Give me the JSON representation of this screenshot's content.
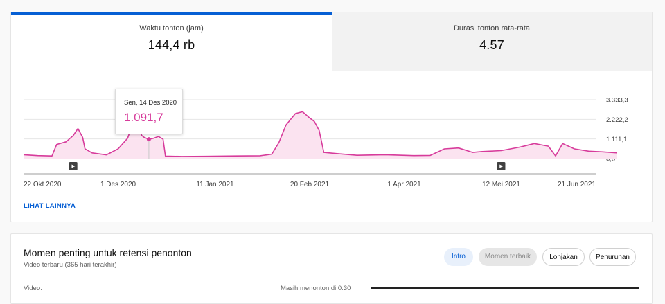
{
  "metrics": [
    {
      "label": "Waktu tonton (jam)",
      "value": "144,4 rb"
    },
    {
      "label": "Durasi tonton rata-rata",
      "value": "4.57"
    }
  ],
  "colors": {
    "accent": "#065fd4",
    "series": "#d73b9b",
    "series_fill": "#fbe3f0"
  },
  "tooltip": {
    "date": "Sen, 14 Des 2020",
    "value": "1.091,7"
  },
  "see_more": "LIHAT LAINNYA",
  "icons": {
    "video_marker": "play-icon"
  },
  "retention": {
    "title": "Momen penting untuk retensi penonton",
    "subtitle": "Video terbaru (365 hari terakhir)",
    "chips": [
      "Intro",
      "Momen terbaik",
      "Lonjakan",
      "Penurunan"
    ],
    "selected_chip": "Intro",
    "cut_left": "Video:",
    "cut_right": "Masih menonton di 0:30"
  },
  "chart_data": {
    "type": "area",
    "metric": "Waktu tonton (jam)",
    "x_labels": [
      "22 Okt 2020",
      "1 Des 2020",
      "11 Jan 2021",
      "20 Feb 2021",
      "1 Apr 2021",
      "12 Mei 2021",
      "21 Jun 2021"
    ],
    "x_start": "2020-10-22",
    "y_ticks": [
      "0,0",
      "1.111,1",
      "2.222,2",
      "3.333,3"
    ],
    "y_tick_values": [
      0,
      1111.1,
      2222.2,
      3333.3
    ],
    "ylim": [
      0,
      3333.3
    ],
    "video_markers": [
      "2020-11-12",
      "2021-05-12"
    ],
    "highlight": {
      "date": "2020-12-14",
      "value": 1091.7
    },
    "series": [
      {
        "date": "2020-10-22",
        "value": 220
      },
      {
        "date": "2020-10-28",
        "value": 170
      },
      {
        "date": "2020-11-03",
        "value": 150
      },
      {
        "date": "2020-11-05",
        "value": 800
      },
      {
        "date": "2020-11-09",
        "value": 950
      },
      {
        "date": "2020-11-12",
        "value": 1300
      },
      {
        "date": "2020-11-14",
        "value": 1700
      },
      {
        "date": "2020-11-16",
        "value": 1200
      },
      {
        "date": "2020-11-17",
        "value": 550
      },
      {
        "date": "2020-11-20",
        "value": 320
      },
      {
        "date": "2020-11-26",
        "value": 210
      },
      {
        "date": "2020-12-01",
        "value": 550
      },
      {
        "date": "2020-12-05",
        "value": 1150
      },
      {
        "date": "2020-12-07",
        "value": 1900
      },
      {
        "date": "2020-12-09",
        "value": 2050
      },
      {
        "date": "2020-12-11",
        "value": 1300
      },
      {
        "date": "2020-12-12",
        "value": 1200
      },
      {
        "date": "2020-12-14",
        "value": 1091.7
      },
      {
        "date": "2020-12-16",
        "value": 1150
      },
      {
        "date": "2020-12-18",
        "value": 1250
      },
      {
        "date": "2020-12-20",
        "value": 1100
      },
      {
        "date": "2020-12-21",
        "value": 140
      },
      {
        "date": "2020-12-28",
        "value": 120
      },
      {
        "date": "2021-01-07",
        "value": 130
      },
      {
        "date": "2021-01-20",
        "value": 150
      },
      {
        "date": "2021-01-30",
        "value": 160
      },
      {
        "date": "2021-02-04",
        "value": 250
      },
      {
        "date": "2021-02-07",
        "value": 900
      },
      {
        "date": "2021-02-10",
        "value": 1900
      },
      {
        "date": "2021-02-14",
        "value": 2550
      },
      {
        "date": "2021-02-17",
        "value": 2650
      },
      {
        "date": "2021-02-20",
        "value": 2300
      },
      {
        "date": "2021-02-22",
        "value": 2100
      },
      {
        "date": "2021-02-24",
        "value": 1600
      },
      {
        "date": "2021-02-26",
        "value": 350
      },
      {
        "date": "2021-03-04",
        "value": 280
      },
      {
        "date": "2021-03-12",
        "value": 190
      },
      {
        "date": "2021-03-24",
        "value": 220
      },
      {
        "date": "2021-04-05",
        "value": 170
      },
      {
        "date": "2021-04-12",
        "value": 180
      },
      {
        "date": "2021-04-18",
        "value": 550
      },
      {
        "date": "2021-04-24",
        "value": 600
      },
      {
        "date": "2021-04-30",
        "value": 350
      },
      {
        "date": "2021-05-04",
        "value": 400
      },
      {
        "date": "2021-05-12",
        "value": 450
      },
      {
        "date": "2021-05-20",
        "value": 650
      },
      {
        "date": "2021-05-26",
        "value": 850
      },
      {
        "date": "2021-06-01",
        "value": 700
      },
      {
        "date": "2021-06-04",
        "value": 150
      },
      {
        "date": "2021-06-07",
        "value": 850
      },
      {
        "date": "2021-06-12",
        "value": 550
      },
      {
        "date": "2021-06-18",
        "value": 420
      },
      {
        "date": "2021-06-24",
        "value": 380
      },
      {
        "date": "2021-06-30",
        "value": 320
      }
    ]
  }
}
